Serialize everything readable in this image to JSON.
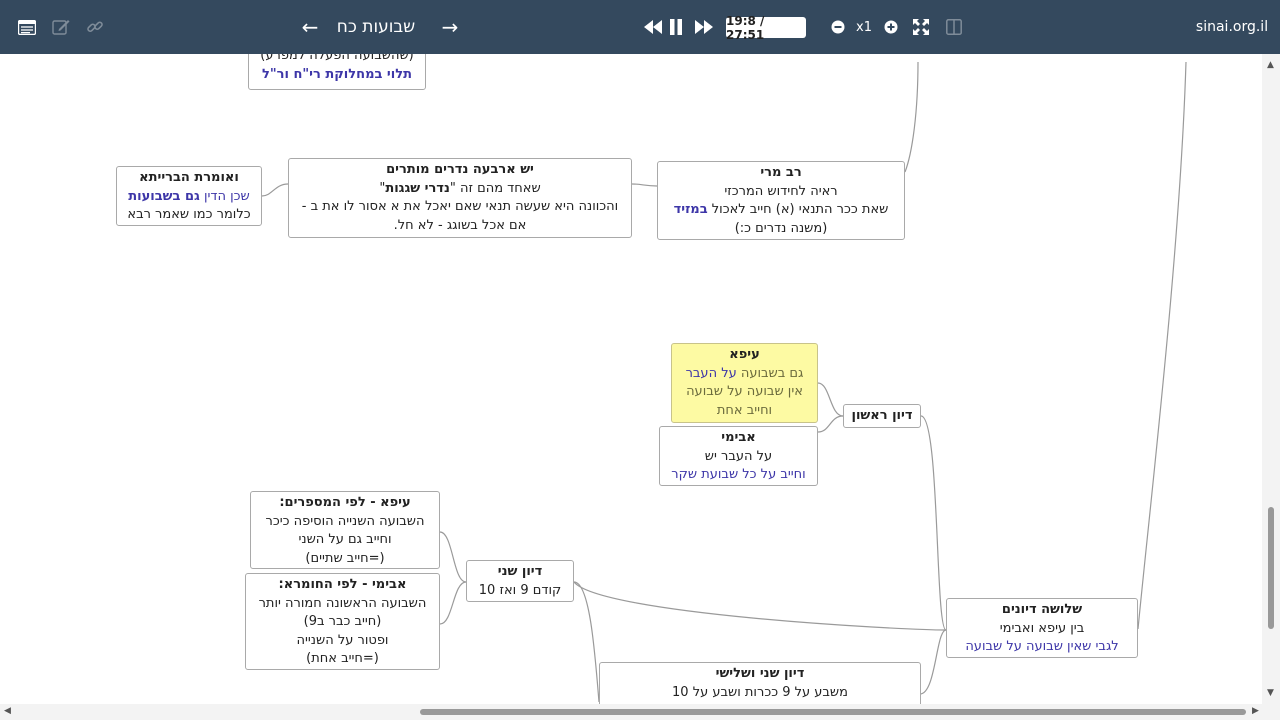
{
  "toolbar": {
    "title": "שבועות כח",
    "prev_arrow": "←",
    "next_arrow": "→",
    "time": "19:8 / 27:51",
    "speed": "x1",
    "site": "sinai.org.il"
  },
  "nodes": {
    "top_partial": {
      "line1": "(שהשבועה הפעלה למפרע)",
      "line2": "תלוי במחלוקת רי\"ח ור\"ל"
    },
    "rav_mari": {
      "title": "רב מרי",
      "line1": "ראיה לחידוש המרכזי",
      "line2_a": "שאת ככר התנאי (א) חייב לאכול ",
      "line2_b": "במזיד",
      "line3": "(משנה נדרים כ:)"
    },
    "four_vows": {
      "title": "יש ארבעה נדרים מותרים",
      "line1_a": "שאחד מהם זה \"",
      "line1_b": "נדרי שגגות",
      "line1_c": "\"",
      "line2": "והכוונה היא שעשה תנאי שאם יאכל את א אסור לו את ב -",
      "line3": "אם אכל בשוגג - לא חל."
    },
    "beraita": {
      "title": "ואומרת הברייתא",
      "line1_a": "שכן הדין ",
      "line1_b": "גם בשבועות",
      "line2": "כלומר כמו שאמר רבא"
    },
    "eifa": {
      "title": "עיפא",
      "line1_a": "גם בשבועה ",
      "line1_b": "על העבר",
      "line2": "אין שבועה על שבועה",
      "line3": "וחייב אחת"
    },
    "abaye": {
      "title": "אבימי",
      "line1": "על העבר יש",
      "line2": "וחייב על כל שבועת שקר"
    },
    "first_discussion": {
      "title": "דיון ראשון"
    },
    "eifa_numbers": {
      "title": "עיפא  - לפי המספרים:",
      "line1": "השבועה השנייה הוסיפה כיכר",
      "line2": "וחייב גם על השני",
      "line3": "(=חייב שתיים)"
    },
    "abaye_severity": {
      "title": "אבימי - לפי החומרא:",
      "line1": "השבועה הראשונה חמורה יותר",
      "line2": "(חייב כבר ב9)",
      "line3": "ופטור על השנייה",
      "line4": "(=חייב אחת)"
    },
    "second_discussion": {
      "title": "דיון שני",
      "line1": "קודם 9 ואז 10"
    },
    "three_discussions": {
      "title": "שלושה דיונים",
      "line1": "בין עיפא ואבימי",
      "line2": "לגבי שאין שבועה על שבועה"
    },
    "second_third_discussion": {
      "title": "דיון שני ושלישי",
      "line1": "משבע על 9 ככרות ושבע על 10"
    }
  },
  "icons": [
    "menu-list-icon",
    "edit-icon",
    "link-icon",
    "rewind-icon",
    "pause-icon",
    "fast-forward-icon",
    "zoom-out-icon",
    "zoom-in-icon",
    "fullscreen-icon",
    "split-view-icon"
  ],
  "colors": {
    "toolbar_bg": "#34495e",
    "link_blue": "#3d36a8",
    "highlight_yellow": "#fdfaa3"
  }
}
